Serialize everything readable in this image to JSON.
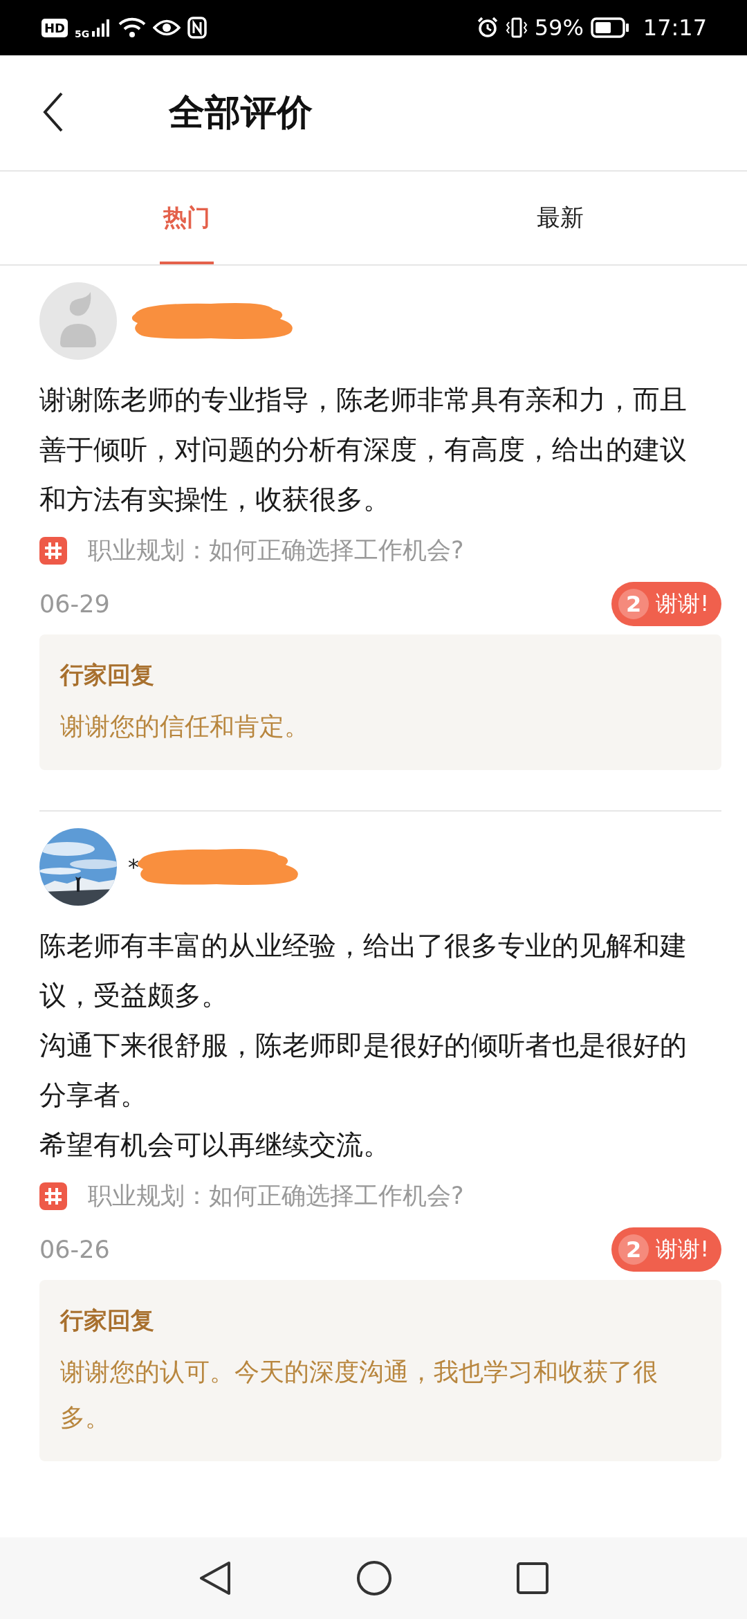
{
  "status_bar": {
    "hd": "HD",
    "network": "5G",
    "battery": "59%",
    "time": "17:17"
  },
  "header": {
    "title": "全部评价"
  },
  "tabs": [
    {
      "label": "热门",
      "selected": true
    },
    {
      "label": "最新",
      "selected": false
    }
  ],
  "reviews": [
    {
      "avatar": {
        "kind": "default"
      },
      "paragraphs": [
        "谢谢陈老师的专业指导，陈老师非常具有亲和力，而且善于倾听，对问题的分析有深度，有高度，给出的建议和方法有实操性，收获很多。"
      ],
      "topic": "职业规划：如何正确选择工作机会?",
      "date": "06-29",
      "thanks": {
        "count": "2",
        "label": "谢谢!"
      },
      "reply": {
        "title": "行家回复",
        "text": "谢谢您的信任和肯定。"
      }
    },
    {
      "name": "*",
      "paragraphs": [
        "陈老师有丰富的从业经验，给出了很多专业的见解和建议，受益颇多。",
        "沟通下来很舒服，陈老师即是很好的倾听者也是很好的分享者。",
        "希望有机会可以再继续交流。"
      ],
      "topic": "职业规划：如何正确选择工作机会?",
      "date": "06-26",
      "thanks": {
        "count": "2",
        "label": "谢谢!"
      },
      "reply": {
        "title": "行家回复",
        "text": "谢谢您的认可。今天的深度沟通，我也学习和收获了很多。"
      }
    }
  ]
}
